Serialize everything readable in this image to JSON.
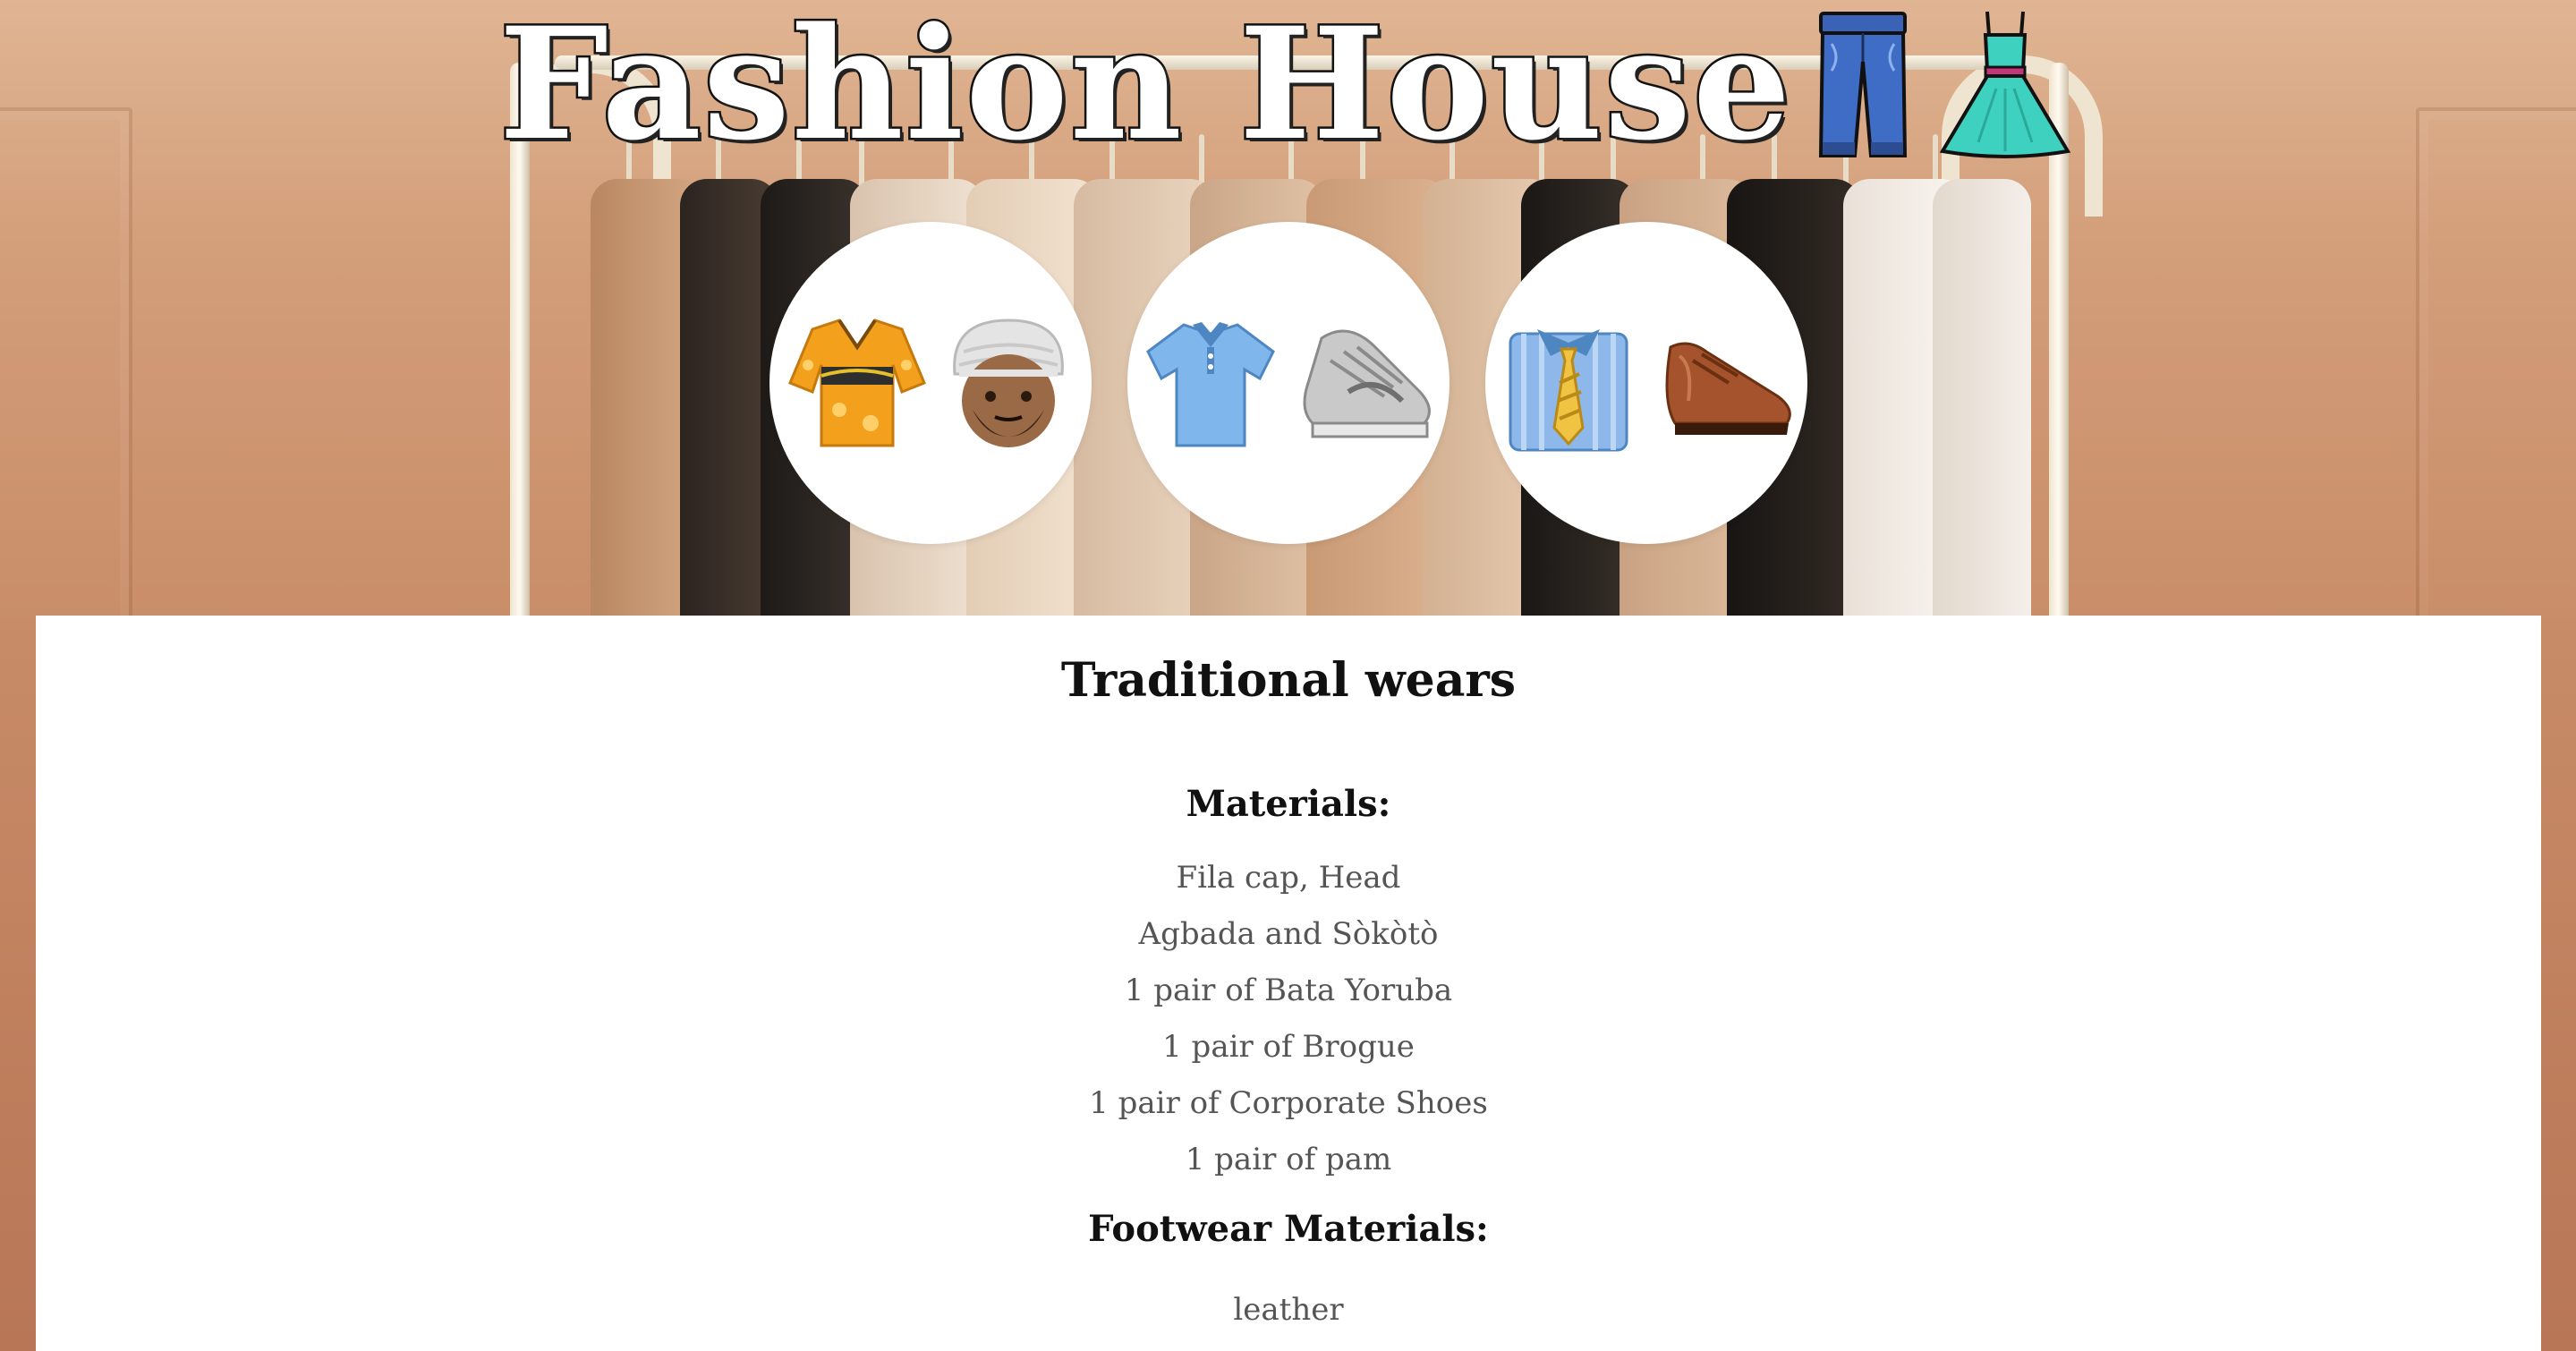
{
  "header": {
    "title": "Fashion House",
    "title_icons": [
      "jeans-icon",
      "dress-icon"
    ]
  },
  "circles": [
    {
      "icons": [
        "kimono-icon",
        "person-with-turban-icon"
      ]
    },
    {
      "icons": [
        "polo-shirt-icon",
        "sneaker-icon"
      ]
    },
    {
      "icons": [
        "shirt-and-tie-icon",
        "dress-shoe-icon"
      ]
    }
  ],
  "main": {
    "section_title": "Traditional wears",
    "materials_heading": "Materials:",
    "materials": [
      "Fila cap, Head",
      "Agbada and Sòkòtò",
      "1 pair of Bata Yoruba",
      "1 pair of Brogue",
      "1 pair of Corporate Shoes",
      "1 pair of pam"
    ],
    "footwear_heading": "Footwear Materials:",
    "footwear": [
      "leather"
    ]
  },
  "colors": {
    "background": "#d39e7a",
    "card": "#ffffff",
    "text": "#111111",
    "muted_text": "#555555"
  }
}
